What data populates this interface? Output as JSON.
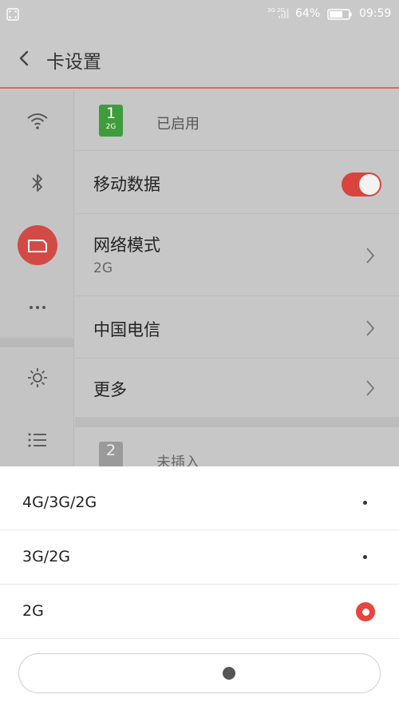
{
  "status_bar": {
    "network_type": "3G 2G",
    "battery_percent": "64%",
    "time": "09:59"
  },
  "title_bar": {
    "title": "卡设置"
  },
  "sidebar": {
    "items": [
      {
        "icon": "wifi-icon"
      },
      {
        "icon": "bluetooth-icon"
      },
      {
        "icon": "sim-card-icon",
        "active": true
      },
      {
        "icon": "more-dots-icon"
      },
      {
        "icon": "brightness-icon"
      },
      {
        "icon": "list-icon"
      }
    ]
  },
  "sim1": {
    "number": "1",
    "type": "2G",
    "status": "已启用",
    "rows": [
      {
        "title": "移动数据",
        "toggle": "on"
      },
      {
        "title": "网络模式",
        "subtitle": "2G"
      },
      {
        "title": "中国电信"
      },
      {
        "title": "更多"
      }
    ]
  },
  "sim2": {
    "number": "2",
    "status": "未插入"
  },
  "network_mode_sheet": {
    "options": [
      {
        "label": "4G/3G/2G",
        "selected": false
      },
      {
        "label": "3G/2G",
        "selected": false
      },
      {
        "label": "2G",
        "selected": true
      }
    ]
  },
  "colors": {
    "accent": "#d9443e",
    "sim1_badge": "#3f9c3c",
    "overlay_gray": "#c7c7c7"
  }
}
